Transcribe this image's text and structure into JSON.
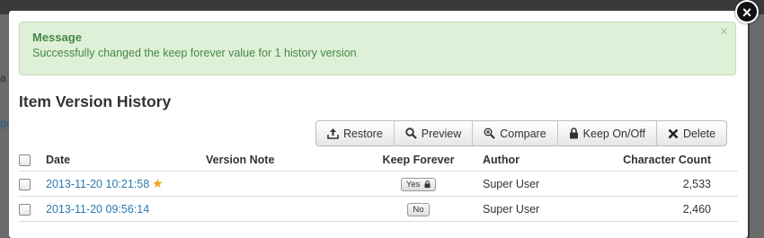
{
  "backdrop": {
    "text_a": "a",
    "text_b": "ge"
  },
  "alert": {
    "title": "Message",
    "body": "Successfully changed the keep forever value for 1 history version",
    "close": "×"
  },
  "heading": "Item Version History",
  "toolbar": {
    "restore": "Restore",
    "preview": "Preview",
    "compare": "Compare",
    "keep": "Keep On/Off",
    "delete": "Delete"
  },
  "table": {
    "headers": {
      "date": "Date",
      "note": "Version Note",
      "keep": "Keep Forever",
      "author": "Author",
      "count": "Character Count"
    },
    "rows": [
      {
        "date": "2013-11-20 10:21:58",
        "note": "",
        "keep": "Yes",
        "author": "Super User",
        "count": "2,533"
      },
      {
        "date": "2013-11-20 09:56:14",
        "note": "",
        "keep": "No",
        "author": "Super User",
        "count": "2,460"
      }
    ]
  },
  "colors": {
    "alert_bg": "#dff0d8",
    "alert_text": "#468847",
    "link": "#2a7ab0",
    "star": "#f0a020"
  }
}
